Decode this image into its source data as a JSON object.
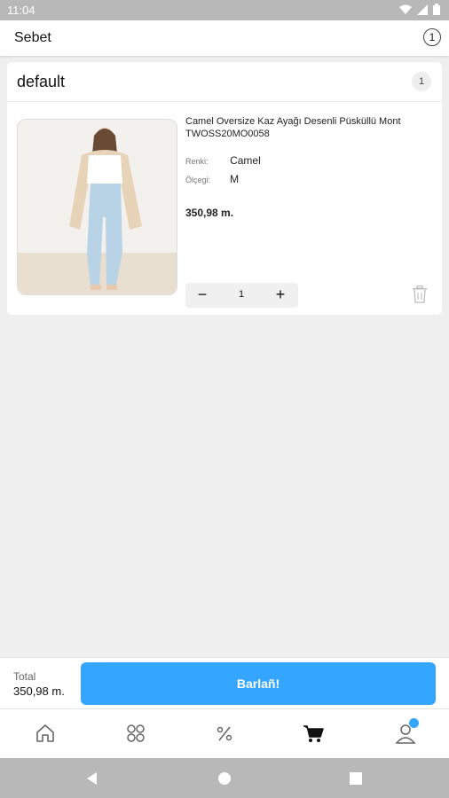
{
  "status_bar": {
    "time": "11:04"
  },
  "header": {
    "title": "Sebet",
    "item_count": "1"
  },
  "cart_group": {
    "name": "default",
    "count": "1",
    "item": {
      "name": "Camel Oversize Kaz Ayağı Desenli Püsküllü Mont TWOSS20MO0058",
      "attributes": [
        {
          "label": "Renki:",
          "value": "Camel"
        },
        {
          "label": "Ölçegi:",
          "value": "M"
        }
      ],
      "price": "350,98 m.",
      "quantity": "1",
      "minus_label": "−",
      "plus_label": "+"
    }
  },
  "checkout": {
    "total_label": "Total",
    "total_value": "350,98 m.",
    "button_label": "Barlañ!"
  },
  "bottom_nav": {
    "items": [
      {
        "icon": "home-icon"
      },
      {
        "icon": "categories-icon"
      },
      {
        "icon": "discount-icon"
      },
      {
        "icon": "cart-icon",
        "active": true
      },
      {
        "icon": "profile-icon",
        "badge": true
      }
    ]
  },
  "colors": {
    "accent": "#35a6ff",
    "background": "#efefef",
    "status_bar": "#b8b8b8"
  }
}
